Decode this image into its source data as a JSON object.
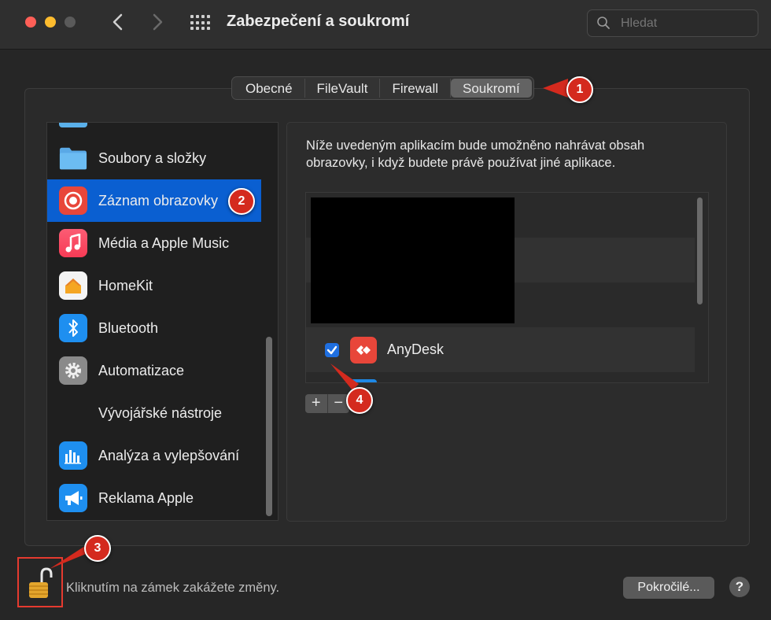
{
  "window": {
    "title": "Zabezpečení a soukromí"
  },
  "search": {
    "placeholder": "Hledat"
  },
  "tabs": [
    {
      "label": "Obecné"
    },
    {
      "label": "FileVault"
    },
    {
      "label": "Firewall"
    },
    {
      "label": "Soukromí",
      "active": true
    }
  ],
  "sidebar": {
    "items": [
      {
        "label": "Soubory a složky",
        "icon": "folder-icon"
      },
      {
        "label": "Záznam obrazovky",
        "icon": "screen-record-icon",
        "selected": true
      },
      {
        "label": "Média a Apple Music",
        "icon": "music-icon"
      },
      {
        "label": "HomeKit",
        "icon": "home-icon"
      },
      {
        "label": "Bluetooth",
        "icon": "bluetooth-icon"
      },
      {
        "label": "Automatizace",
        "icon": "gear-icon"
      },
      {
        "label": "Vývojářské nástroje",
        "icon": ""
      },
      {
        "label": "Analýza a vylepšování",
        "icon": "chart-icon"
      },
      {
        "label": "Reklama Apple",
        "icon": "megaphone-icon"
      }
    ]
  },
  "content": {
    "description": "Níže uvedeným aplikacím bude umožněno nahrávat obsah obrazovky, i když budete právě používat jiné aplikace.",
    "apps": [
      {
        "name": "AnyDesk",
        "checked": true,
        "icon": "anydesk-icon"
      }
    ],
    "add_label": "+",
    "remove_label": "−"
  },
  "footer": {
    "lock_text": "Kliknutím na zámek zakážete změny.",
    "advanced_label": "Pokročilé...",
    "help_label": "?"
  },
  "callouts": [
    "1",
    "2",
    "3",
    "4"
  ],
  "colors": {
    "accent": "#0a5fd1",
    "callout": "#d42a1e"
  }
}
